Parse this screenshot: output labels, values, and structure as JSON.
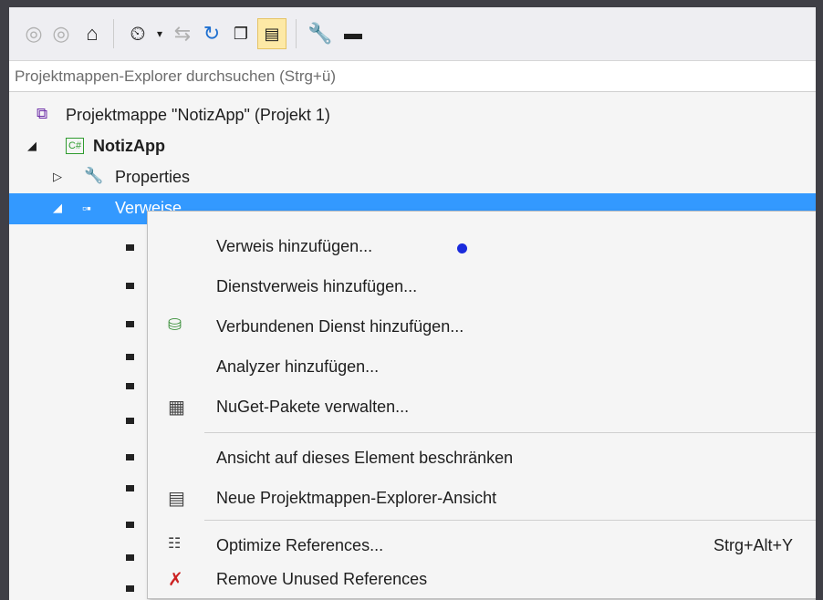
{
  "search": {
    "placeholder": "Projektmappen-Explorer durchsuchen (Strg+ü)"
  },
  "toolbar": {
    "icons": [
      "back-icon",
      "forward-icon",
      "home-icon",
      "pending-changes-icon",
      "dropdown-arrow-icon",
      "sync-icon",
      "refresh-icon",
      "collapse-all-icon",
      "show-all-files-icon",
      "properties-wrench-icon",
      "preview-icon"
    ]
  },
  "tree": {
    "solution": "Projektmappe \"NotizApp\" (Projekt 1)",
    "project": "NotizApp",
    "project_badge": "C#",
    "properties": "Properties",
    "references": "Verweise"
  },
  "menu": {
    "items": [
      {
        "label": "Verweis hinzufügen...",
        "icon": ""
      },
      {
        "label": "Dienstverweis hinzufügen...",
        "icon": ""
      },
      {
        "label": "Verbundenen Dienst hinzufügen...",
        "icon": "connected-service-icon"
      },
      {
        "label": "Analyzer hinzufügen...",
        "icon": ""
      },
      {
        "label": "NuGet-Pakete verwalten...",
        "icon": "nuget-icon"
      },
      {
        "label": "Ansicht auf dieses Element beschränken",
        "icon": ""
      },
      {
        "label": "Neue Projektmappen-Explorer-Ansicht",
        "icon": "new-view-icon"
      },
      {
        "label": "Optimize References...",
        "icon": "optimize-icon",
        "shortcut": "Strg+Alt+Y"
      },
      {
        "label": "Remove Unused References",
        "icon": "remove-refs-icon"
      }
    ]
  },
  "colors": {
    "selection": "#3399ff",
    "cursor_dot": "#1a2bdc",
    "csharp_badge": "#2e9b2e"
  }
}
